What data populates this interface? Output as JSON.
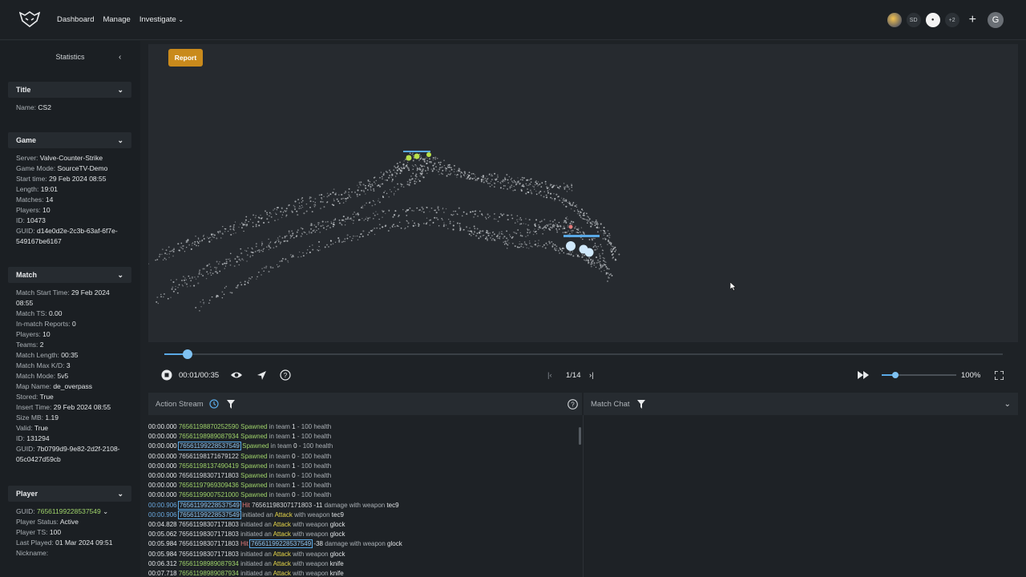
{
  "nav": {
    "items": [
      "Dashboard",
      "Manage",
      "Investigate"
    ]
  },
  "top_right": {
    "avatars": [
      "SD",
      "+2"
    ],
    "user_initial": "G"
  },
  "sidebar": {
    "title": "Statistics",
    "sections": {
      "title_section": {
        "heading": "Title",
        "rows": [
          [
            "Name:",
            "CS2"
          ]
        ]
      },
      "game": {
        "heading": "Game",
        "rows": [
          [
            "Server:",
            "Valve-Counter-Strike"
          ],
          [
            "Game Mode:",
            "SourceTV-Demo"
          ],
          [
            "Start time:",
            "29 Feb 2024 08:55"
          ],
          [
            "Length:",
            "19:01"
          ],
          [
            "Matches:",
            "14"
          ],
          [
            "Players:",
            "10"
          ],
          [
            "ID:",
            "10473"
          ],
          [
            "GUID:",
            "d14e0d2e-2c3b-63af-6f7e-549167be6167"
          ]
        ]
      },
      "match": {
        "heading": "Match",
        "rows": [
          [
            "Match Start Time:",
            "29 Feb 2024 08:55"
          ],
          [
            "Match TS:",
            "0.00"
          ],
          [
            "In-match Reports:",
            "0"
          ],
          [
            "Players:",
            "10"
          ],
          [
            "Teams:",
            "2"
          ],
          [
            "Match Length:",
            "00:35"
          ],
          [
            "Match Max K/D:",
            "3"
          ],
          [
            "Match Mode:",
            "5v5"
          ],
          [
            "Map Name:",
            "de_overpass"
          ],
          [
            "Stored:",
            "True"
          ],
          [
            "Insert Time:",
            "29 Feb 2024 08:55"
          ],
          [
            "Size MB:",
            "1.19"
          ],
          [
            "Valid:",
            "True"
          ],
          [
            "ID:",
            "131294"
          ],
          [
            "GUID:",
            "7b0799d9-9e82-2d2f-2108-05c0427d59cb"
          ]
        ]
      },
      "player": {
        "heading": "Player",
        "guid_label": "GUID:",
        "guid_value": "76561199228537549",
        "rows": [
          [
            "Player Status:",
            "Active"
          ],
          [
            "Player TS:",
            "100"
          ],
          [
            "Last Played:",
            "01 Mar 2024 09:51"
          ],
          [
            "Nickname:",
            ""
          ]
        ]
      }
    }
  },
  "viewer": {
    "report_label": "Report",
    "progress": 0.028
  },
  "controls": {
    "time": "00:01/00:35",
    "match_index": "1/14",
    "zoom": "100%",
    "volume": 0.18
  },
  "action_stream": {
    "title": "Action Stream",
    "rows": [
      {
        "ts": "00:00.000",
        "id": "76561198870252590",
        "id_style": "g",
        "action": "Spawned",
        "rest": "in team",
        "team": "1",
        "sep": "-",
        "hp": "100",
        "tail": "health"
      },
      {
        "ts": "00:00.000",
        "id": "76561198989087934",
        "id_style": "g",
        "action": "Spawned",
        "rest": "in team",
        "team": "1",
        "sep": "-",
        "hp": "100",
        "tail": "health"
      },
      {
        "ts": "00:00.000",
        "id": "76561199228537549",
        "id_style": "boxed",
        "action": "Spawned",
        "rest": "in team",
        "team": "0",
        "sep": "-",
        "hp": "100",
        "tail": "health"
      },
      {
        "ts": "00:00.000",
        "id": "76561198171679122",
        "id_style": "w",
        "action": "Spawned",
        "rest": "in team",
        "team": "0",
        "sep": "-",
        "hp": "100",
        "tail": "health"
      },
      {
        "ts": "00:00.000",
        "id": "76561198137490419",
        "id_style": "g",
        "action": "Spawned",
        "rest": "in team",
        "team": "1",
        "sep": "-",
        "hp": "100",
        "tail": "health"
      },
      {
        "ts": "00:00.000",
        "id": "76561198307171803",
        "id_style": "w",
        "action": "Spawned",
        "rest": "in team",
        "team": "0",
        "sep": "-",
        "hp": "100",
        "tail": "health"
      },
      {
        "ts": "00:00.000",
        "id": "76561197969309436",
        "id_style": "g",
        "action": "Spawned",
        "rest": "in team",
        "team": "1",
        "sep": "-",
        "hp": "100",
        "tail": "health"
      },
      {
        "ts": "00:00.000",
        "id": "76561199007521000",
        "id_style": "g",
        "action": "Spawned",
        "rest": "in team",
        "team": "0",
        "sep": "-",
        "hp": "100",
        "tail": "health"
      }
    ],
    "event_rows": [
      {
        "ts": "00:00.906",
        "ts_style": "blue",
        "parts": [
          [
            "boxed",
            "76561199228537549"
          ],
          [
            "hit",
            "Hit"
          ],
          [
            "w",
            "76561198307171803"
          ],
          [
            "num",
            "-11"
          ],
          [
            "plain",
            "damage with weapon"
          ],
          [
            "num",
            "tec9"
          ]
        ]
      },
      {
        "ts": "00:00.906",
        "ts_style": "blue",
        "parts": [
          [
            "boxed",
            "76561199228537549"
          ],
          [
            "plain",
            "initiated an"
          ],
          [
            "attack",
            "Attack"
          ],
          [
            "plain",
            "with weapon"
          ],
          [
            "num",
            "tec9"
          ]
        ]
      },
      {
        "ts": "00:04.828",
        "ts_style": "",
        "parts": [
          [
            "w",
            "76561198307171803"
          ],
          [
            "plain",
            "initiated an"
          ],
          [
            "attack",
            "Attack"
          ],
          [
            "plain",
            "with weapon"
          ],
          [
            "num",
            "glock"
          ]
        ]
      },
      {
        "ts": "00:05.062",
        "ts_style": "",
        "parts": [
          [
            "w",
            "76561198307171803"
          ],
          [
            "plain",
            "initiated an"
          ],
          [
            "attack",
            "Attack"
          ],
          [
            "plain",
            "with weapon"
          ],
          [
            "num",
            "glock"
          ]
        ]
      },
      {
        "ts": "00:05.984",
        "ts_style": "",
        "parts": [
          [
            "w",
            "76561198307171803"
          ],
          [
            "hit",
            "Hit"
          ],
          [
            "boxed",
            "76561199228537549"
          ],
          [
            "num",
            "-38"
          ],
          [
            "plain",
            "damage with weapon"
          ],
          [
            "num",
            "glock"
          ]
        ]
      },
      {
        "ts": "00:05.984",
        "ts_style": "",
        "parts": [
          [
            "w",
            "76561198307171803"
          ],
          [
            "plain",
            "initiated an"
          ],
          [
            "attack",
            "Attack"
          ],
          [
            "plain",
            "with weapon"
          ],
          [
            "num",
            "glock"
          ]
        ]
      },
      {
        "ts": "00:06.312",
        "ts_style": "",
        "parts": [
          [
            "g",
            "76561198989087934"
          ],
          [
            "plain",
            "initiated an"
          ],
          [
            "attack",
            "Attack"
          ],
          [
            "plain",
            "with weapon"
          ],
          [
            "num",
            "knife"
          ]
        ]
      },
      {
        "ts": "00:07.718",
        "ts_style": "",
        "parts": [
          [
            "g",
            "76561198989087934"
          ],
          [
            "plain",
            "initiated an"
          ],
          [
            "attack",
            "Attack"
          ],
          [
            "plain",
            "with weapon"
          ],
          [
            "num",
            "knife"
          ]
        ]
      }
    ]
  },
  "match_chat": {
    "title": "Match Chat"
  },
  "colors": {
    "accent": "#5aa9e6",
    "report": "#c98a1c",
    "green_id": "#9fd36a",
    "attack": "#e8d84a",
    "hit": "#e37b7b"
  }
}
